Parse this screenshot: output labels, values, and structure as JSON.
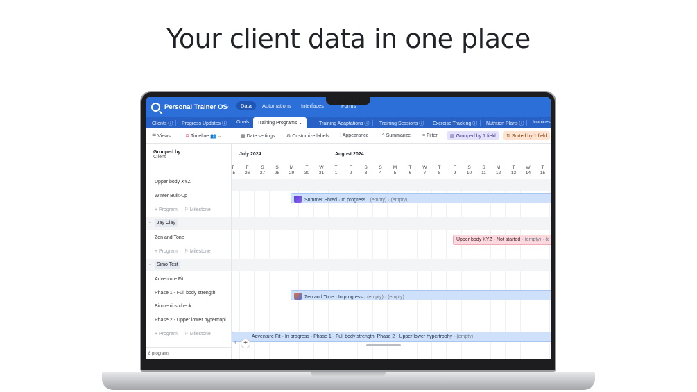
{
  "headline": "Your client data in one place",
  "app": {
    "title": "Personal Trainer OS",
    "nav": [
      "Data",
      "Automations",
      "Interfaces",
      "Forms"
    ],
    "active_nav": "Data",
    "accent": "#2d6fd8"
  },
  "tabs": [
    {
      "label": "Clients",
      "info": true
    },
    {
      "label": "Progress Updates",
      "info": true
    },
    {
      "label": "Goals",
      "info": false
    },
    {
      "label": "Training Programs",
      "info": false,
      "active": true
    },
    {
      "label": "Training Adaptations",
      "info": true
    },
    {
      "label": "Training Sessions",
      "info": true
    },
    {
      "label": "Exercise Tracking",
      "info": true
    },
    {
      "label": "Nutrition Plans",
      "info": true
    },
    {
      "label": "Invoices",
      "info": false
    }
  ],
  "toolbar": {
    "views": "Views",
    "timeline": "Timeline",
    "date_settings": "Date settings",
    "customize_labels": "Customize labels",
    "appearance": "Appearance",
    "summarize": "Summarize",
    "filter": "Filter",
    "grouped": "Grouped by 1 field",
    "sorted": "Sorted by 1 field"
  },
  "left_panel": {
    "grouped_by": "Grouped by",
    "group_field": "Client",
    "rows_top": [
      "Upper body XYZ",
      "Winter Bulk-Up"
    ],
    "add_program": "+ Program",
    "add_milestone": "Milestone",
    "groups": [
      {
        "name": "Jay Clay",
        "rows": [
          "Zen and Tone"
        ]
      },
      {
        "name": "Simo Test",
        "rows": [
          "Adventure Fit",
          "Phase 1 - Full body strength",
          "Biometrics check",
          "Phase 2 - Upper lower hypertropl"
        ]
      }
    ],
    "footer": "8 programs"
  },
  "timeline": {
    "months": [
      "July 2024",
      "August 2024"
    ],
    "days": [
      {
        "d": "T",
        "n": "25"
      },
      {
        "d": "F",
        "n": "26"
      },
      {
        "d": "S",
        "n": "27"
      },
      {
        "d": "S",
        "n": "28"
      },
      {
        "d": "M",
        "n": "29"
      },
      {
        "d": "T",
        "n": "30"
      },
      {
        "d": "W",
        "n": "31"
      },
      {
        "d": "T",
        "n": "1"
      },
      {
        "d": "F",
        "n": "2"
      },
      {
        "d": "S",
        "n": "3"
      },
      {
        "d": "S",
        "n": "4"
      },
      {
        "d": "M",
        "n": "5"
      },
      {
        "d": "T",
        "n": "6"
      },
      {
        "d": "W",
        "n": "7"
      },
      {
        "d": "T",
        "n": "8"
      },
      {
        "d": "F",
        "n": "9"
      },
      {
        "d": "S",
        "n": "10"
      },
      {
        "d": "S",
        "n": "11"
      },
      {
        "d": "M",
        "n": "12"
      },
      {
        "d": "T",
        "n": "13"
      },
      {
        "d": "W",
        "n": "14"
      },
      {
        "d": "T",
        "n": "15"
      }
    ],
    "bars": {
      "summer": {
        "title": "Summer Shred · In progress",
        "extra": "· (empty) · (empty)"
      },
      "upper": {
        "title": "Upper body XYZ · Not started",
        "extra": "· (empty) · (e"
      },
      "zen": {
        "title": "Zen and Tone · In progress",
        "extra": "· (empty) · (empty)"
      },
      "adventure": {
        "title": "Adventure Fit · In progress · Phase 1 - Full body strength, Phase 2 - Upper lower hypertrophy",
        "extra": "· (empty)"
      }
    }
  }
}
